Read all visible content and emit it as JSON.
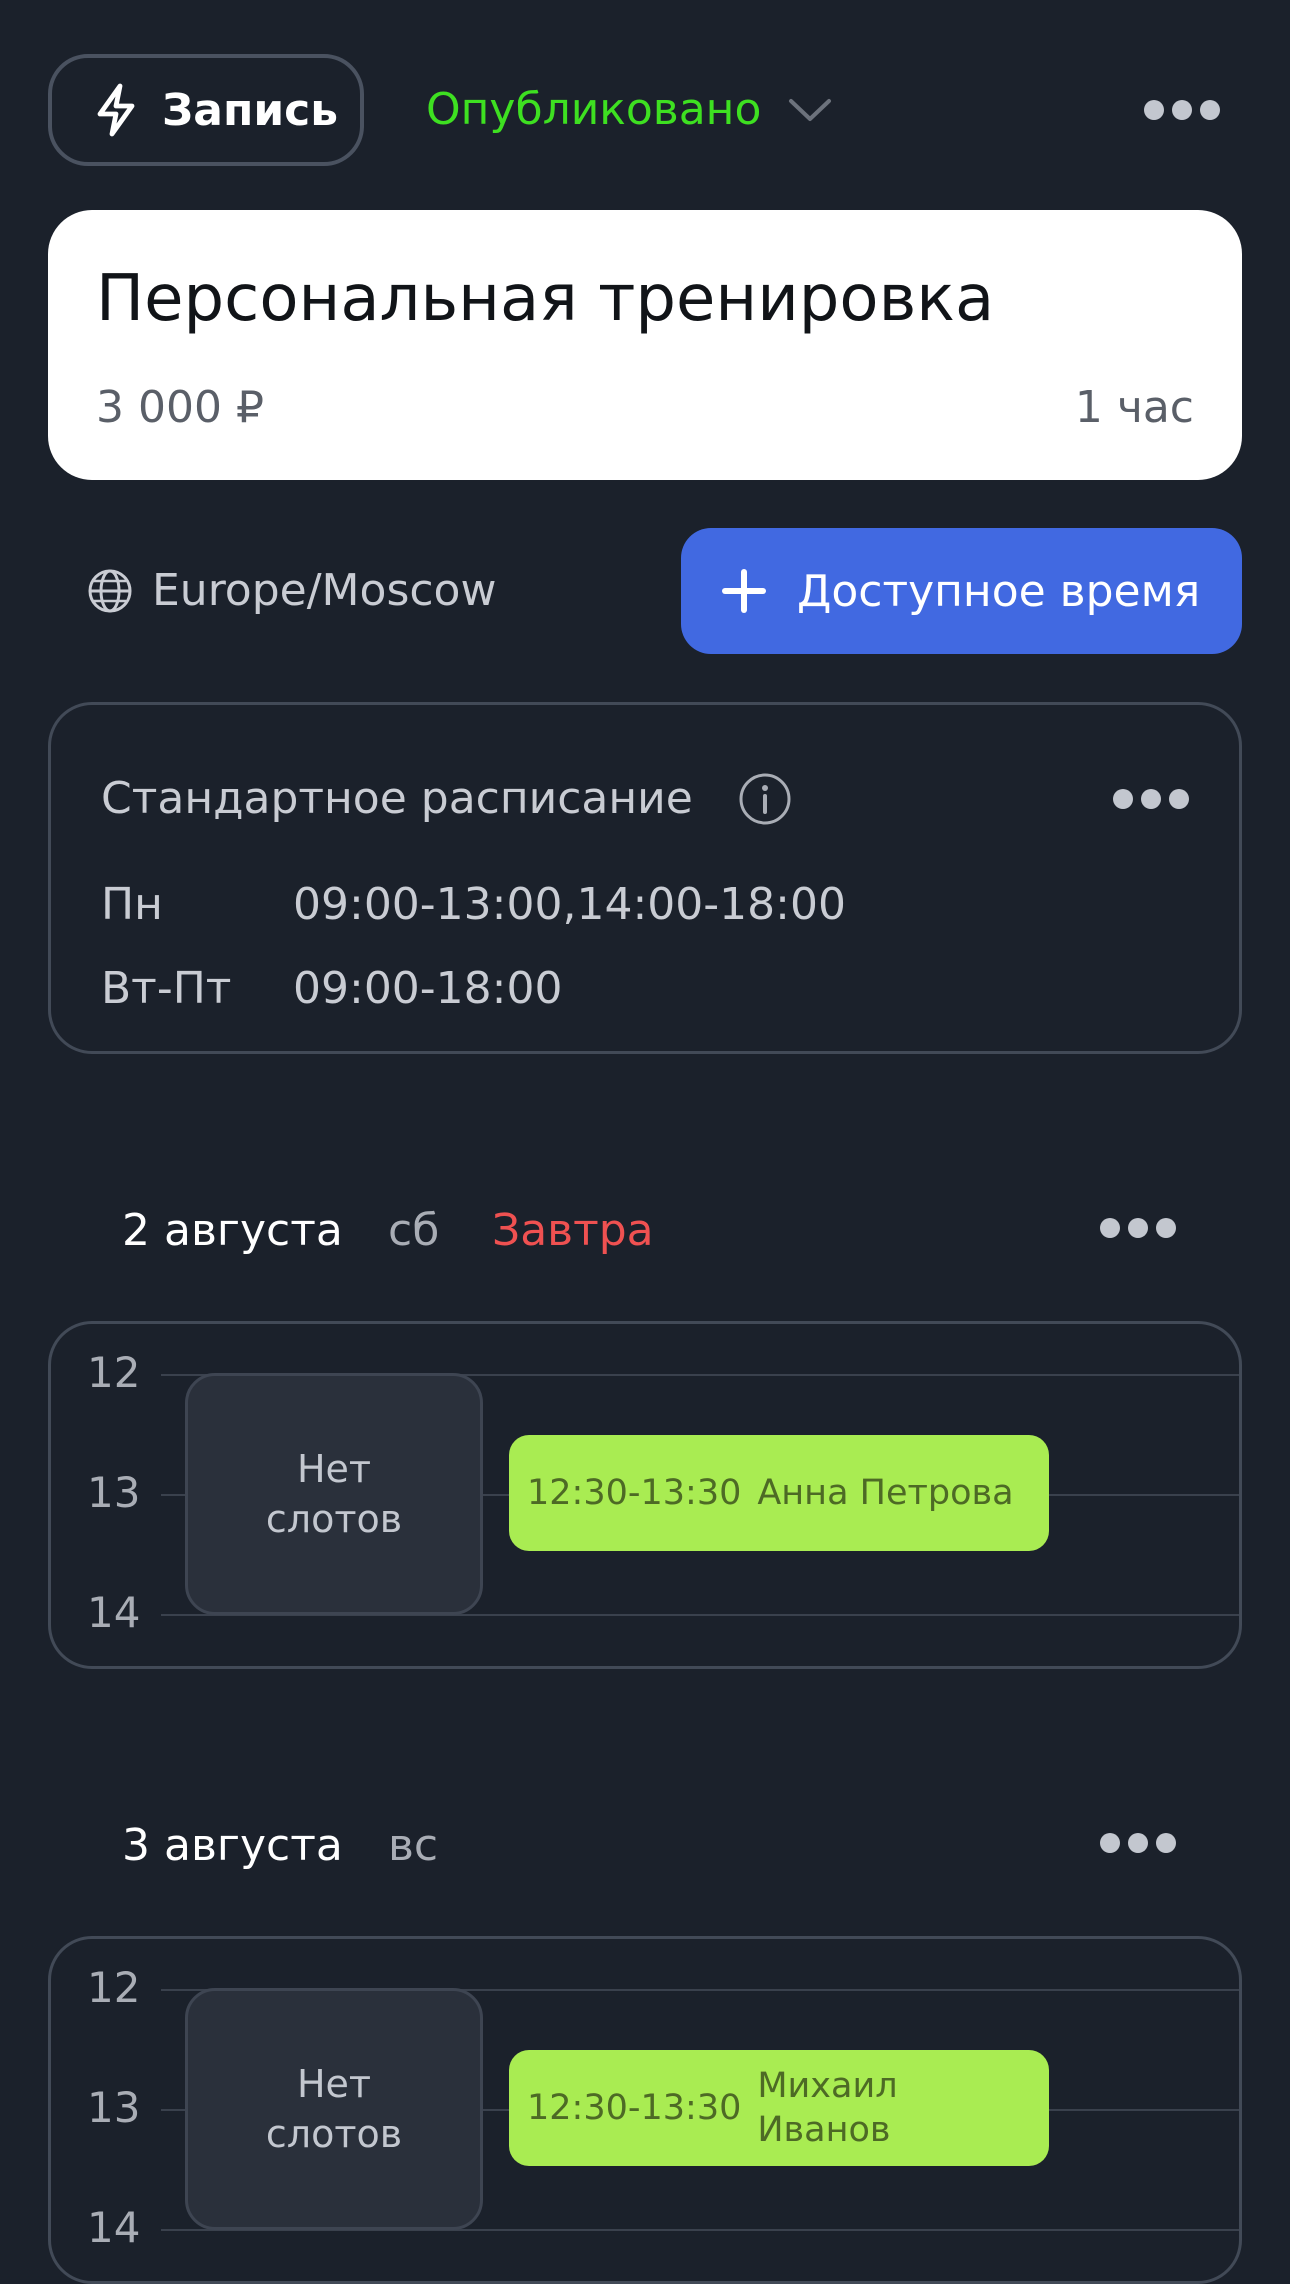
{
  "top_bar": {
    "type_label": "Запись",
    "status_label": "Опубликовано"
  },
  "service": {
    "title": "Персональная тренировка",
    "price": "3 000 ₽",
    "duration": "1 час"
  },
  "timezone": "Europe/Moscow",
  "add_button_label": "Доступное время",
  "schedule": {
    "title": "Стандартное расписание",
    "rows": [
      {
        "days": "Пн",
        "times": "09:00-13:00,14:00-18:00"
      },
      {
        "days": "Вт-Пт",
        "times": "09:00-18:00"
      }
    ]
  },
  "days": [
    {
      "date": "2 августа",
      "weekday": "сб",
      "relative": "Завтра",
      "hours": [
        "12",
        "13",
        "14"
      ],
      "no_slots_line1": "Нет",
      "no_slots_line2": "слотов",
      "booking": {
        "time": "12:30-13:30",
        "name": "Анна Петрова"
      }
    },
    {
      "date": "3 августа",
      "weekday": "вс",
      "hours": [
        "12",
        "13",
        "14"
      ],
      "no_slots_line1": "Нет",
      "no_slots_line2": "слотов",
      "booking": {
        "time": "12:30-13:30",
        "name_line1": "Михаил",
        "name_line2": "Иванов"
      }
    }
  ],
  "colors": {
    "background": "#1b212b",
    "published": "#3ee021",
    "accent_blue": "#4169e1",
    "tomorrow_red": "#ef5151",
    "booking_green": "#a9ec52"
  }
}
